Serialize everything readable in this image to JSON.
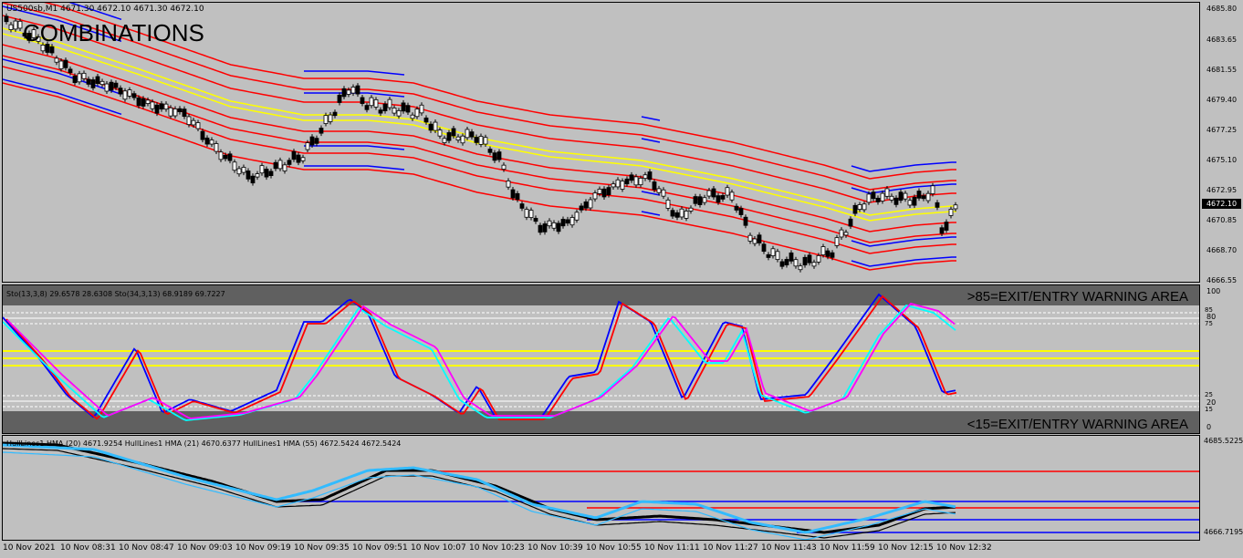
{
  "main": {
    "symbol_line": "US500sb,M1  4671.30 4672.10 4671.30 4672.10",
    "watermark": "COMBINATIONS",
    "current_price": "4672.10",
    "price_ticks": [
      "4685.80",
      "4683.65",
      "4681.55",
      "4679.40",
      "4677.25",
      "4675.10",
      "4672.95",
      "4670.85",
      "4668.70",
      "4666.55"
    ]
  },
  "stoch": {
    "header": "Sto(13,3,8) 29.6578 28.6308  Sto(34,3,13) 68.9189 69.7227",
    "upper_zone": ">85=EXIT/ENTRY WARNING AREA",
    "lower_zone": "<15=EXIT/ENTRY WARNING AREA",
    "ticks": [
      "100",
      "85",
      "80",
      "75",
      "25",
      "20",
      "15",
      "0"
    ]
  },
  "hma": {
    "header": "HullLines1  HMA (20) 4671.9254  HullLines1  HMA (21) 4670.6377  HullLines1  HMA (55) 4672.5424 4672.5424",
    "ticks": [
      "4685.5225",
      "4666.7195"
    ]
  },
  "time_axis": [
    "10 Nov 2021",
    "10 Nov 08:31",
    "10 Nov 08:47",
    "10 Nov 09:03",
    "10 Nov 09:19",
    "10 Nov 09:35",
    "10 Nov 09:51",
    "10 Nov 10:07",
    "10 Nov 10:23",
    "10 Nov 10:39",
    "10 Nov 10:55",
    "10 Nov 11:11",
    "10 Nov 11:27",
    "10 Nov 11:43",
    "10 Nov 11:59",
    "10 Nov 12:15",
    "10 Nov 12:32"
  ],
  "colors": {
    "background": "#c0c0c0",
    "band_red": "#ff0000",
    "band_yellow": "#ffff00",
    "band_blue": "#0000ff",
    "candle": "#000000",
    "stoch_fast": "#0000ff",
    "stoch_signal": "#ff0000",
    "stoch_slow": "#ff00ff",
    "stoch_slow_signal": "#00ffff",
    "hma_fast": "#000000",
    "hma_slow": "#33bbff",
    "zone_fill": "#606060"
  }
}
